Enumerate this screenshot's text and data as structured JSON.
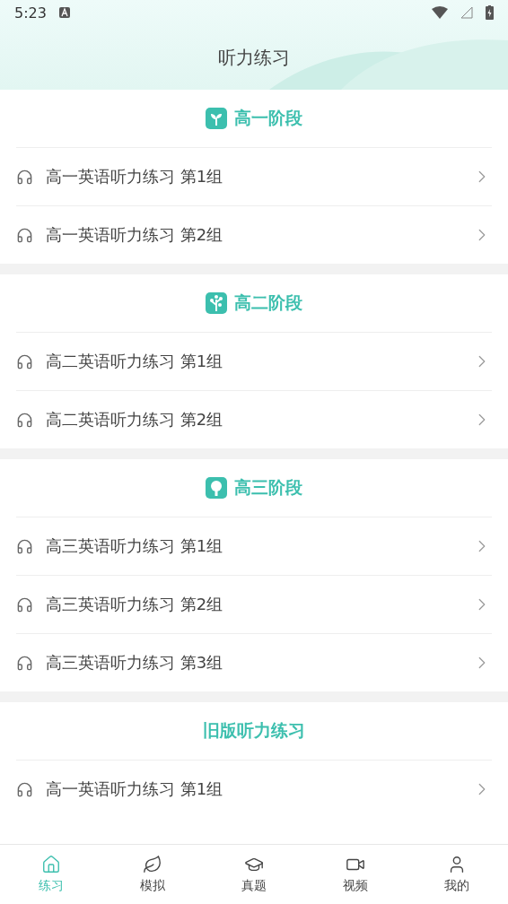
{
  "status_bar": {
    "time": "5:23"
  },
  "header": {
    "title": "听力练习"
  },
  "sections": [
    {
      "title": "高一阶段",
      "items": [
        {
          "label": "高一英语听力练习 第1组"
        },
        {
          "label": "高一英语听力练习 第2组"
        }
      ]
    },
    {
      "title": "高二阶段",
      "items": [
        {
          "label": "高二英语听力练习 第1组"
        },
        {
          "label": "高二英语听力练习 第2组"
        }
      ]
    },
    {
      "title": "高三阶段",
      "items": [
        {
          "label": "高三英语听力练习 第1组"
        },
        {
          "label": "高三英语听力练习 第2组"
        },
        {
          "label": "高三英语听力练习 第3组"
        }
      ]
    },
    {
      "title": "旧版听力练习",
      "items": [
        {
          "label": "高一英语听力练习 第1组"
        }
      ]
    }
  ],
  "tab_bar": [
    {
      "label": "练习",
      "selected": true
    },
    {
      "label": "模拟",
      "selected": false
    },
    {
      "label": "真题",
      "selected": false
    },
    {
      "label": "视频",
      "selected": false
    },
    {
      "label": "我的",
      "selected": false
    }
  ]
}
